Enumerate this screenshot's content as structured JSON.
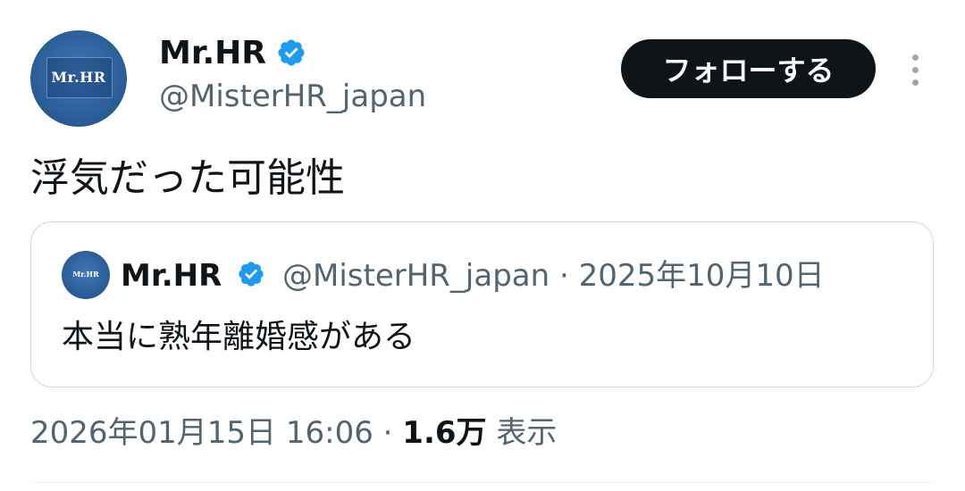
{
  "author": {
    "display_name": "Mr.HR",
    "handle": "@MisterHR_japan",
    "avatar_text": "Mr.HR",
    "verified_icon": "verified-badge-icon"
  },
  "follow_button": {
    "label": "フォローする"
  },
  "more_menu": {
    "icon": "more-vertical-icon"
  },
  "tweet": {
    "text": "浮気だった可能性",
    "timestamp": "2026年01月15日 16:06",
    "separator": "·",
    "views_count": "1.6万",
    "views_label": "表示"
  },
  "quoted_tweet": {
    "display_name": "Mr.HR",
    "avatar_text": "Mr.HR",
    "meta": "@MisterHR_japan · 2025年10月10日",
    "text": "本当に熟年離婚感がある"
  },
  "colors": {
    "text_primary": "#0f1419",
    "text_secondary": "#536471",
    "verified_blue": "#1d9bf0",
    "follow_bg": "#0f1419",
    "border": "#cfd9de"
  }
}
